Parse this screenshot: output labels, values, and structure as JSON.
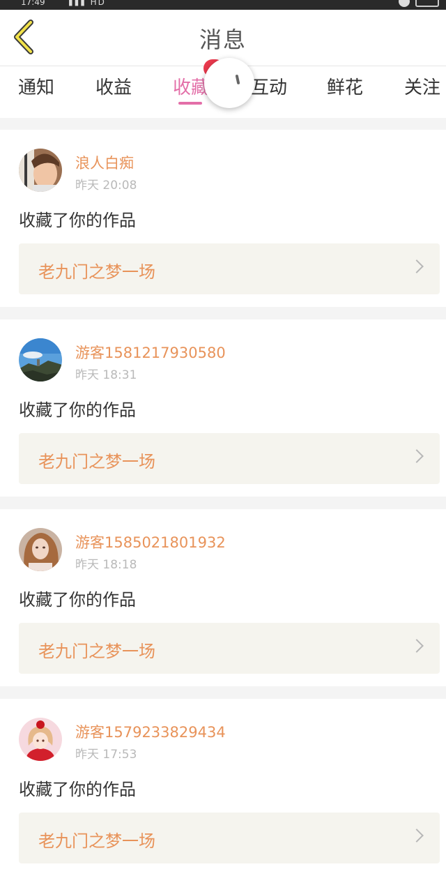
{
  "header": {
    "title": "消息"
  },
  "tabs": [
    {
      "label": "通知"
    },
    {
      "label": "收益"
    },
    {
      "label": "收藏"
    },
    {
      "label": "互动"
    },
    {
      "label": "鲜花"
    },
    {
      "label": "关注"
    }
  ],
  "active_tab_index": 2,
  "notifications": [
    {
      "user": "浪人白痴",
      "time": "昨天 20:08",
      "action": "收藏了你的作品",
      "work": "老九门之梦一场"
    },
    {
      "user": "游客1581217930580",
      "time": "昨天 18:31",
      "action": "收藏了你的作品",
      "work": "老九门之梦一场"
    },
    {
      "user": "游客1585021801932",
      "time": "昨天 18:18",
      "action": "收藏了你的作品",
      "work": "老九门之梦一场"
    },
    {
      "user": "游客1579233829434",
      "time": "昨天 17:53",
      "action": "收藏了你的作品",
      "work": "老九门之梦一场"
    }
  ],
  "colors": {
    "accent_pink": "#e36fa8",
    "name_orange": "#e8935a",
    "badge_red": "#e9394d",
    "back_icon_yellow": "#f2e24a"
  }
}
